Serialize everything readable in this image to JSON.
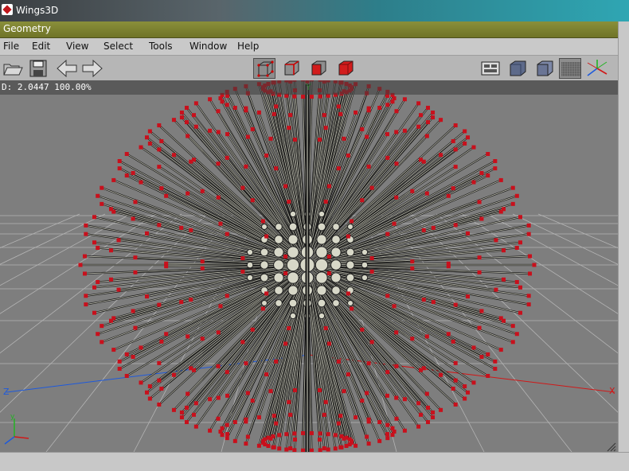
{
  "window": {
    "title": "Wings3D"
  },
  "geometry_bar": {
    "label": "Geometry"
  },
  "menu": [
    "File",
    "Edit",
    "View",
    "Select",
    "Tools",
    "Window",
    "Help"
  ],
  "toolbar": {
    "file_buttons": [
      "open-folder-icon",
      "save-disk-icon",
      "undo-arrow-icon",
      "redo-arrow-icon"
    ],
    "selection_modes": [
      "vertex-mode-icon",
      "edge-mode-icon",
      "face-mode-icon",
      "body-mode-icon"
    ],
    "view_buttons": [
      "wireframe-toggle-icon",
      "smooth-shaded-icon",
      "flat-shaded-icon",
      "ground-plane-icon",
      "axes-icon"
    ]
  },
  "info": {
    "text": "D: 2.0447  100.00%"
  },
  "axes": {
    "y": "Y",
    "z": "Z",
    "x": "X"
  },
  "colors": {
    "viewport_bg": "#7e7e7e",
    "vertex": "#c8101c",
    "spike": "#dcdccc",
    "grid": "#b4b4b4",
    "x_axis": "#d01818",
    "y_axis": "#22b322",
    "z_axis": "#1e5adc"
  }
}
